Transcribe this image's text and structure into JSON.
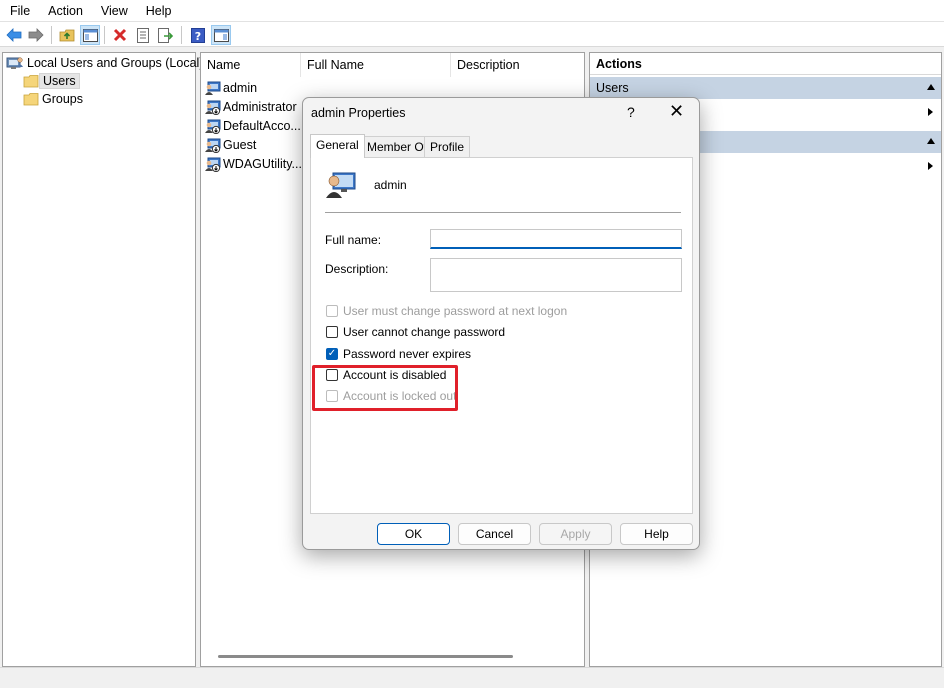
{
  "menu": [
    "File",
    "Action",
    "View",
    "Help"
  ],
  "toolbar": {
    "back": "back-arrow-icon",
    "forward": "forward-arrow-icon",
    "up": "up-folder-icon",
    "show_hide_tree": "console-tree-icon",
    "delete": "delete-icon",
    "properties": "properties-icon",
    "export": "export-icon",
    "help": "help-icon",
    "action_pane": "action-pane-icon"
  },
  "tree": {
    "root": "Local Users and Groups (Local)",
    "items": [
      "Users",
      "Groups"
    ],
    "selected": "Users"
  },
  "list": {
    "columns": [
      "Name",
      "Full Name",
      "Description"
    ],
    "rows": [
      "admin",
      "Administrator",
      "DefaultAcco...",
      "Guest",
      "WDAGUtility..."
    ]
  },
  "actions": {
    "title": "Actions",
    "sections": [
      {
        "label": "Users"
      },
      {
        "label": ""
      }
    ]
  },
  "dialog": {
    "title": "admin Properties",
    "help": "?",
    "close": "✕",
    "tabs": [
      "General",
      "Member Of",
      "Profile"
    ],
    "active_tab": "General",
    "user_name": "admin",
    "full_name_label": "Full name:",
    "full_name_value": "",
    "description_label": "Description:",
    "description_value": "",
    "checkboxes": [
      {
        "label": "User must change password at next logon",
        "checked": false,
        "disabled": true
      },
      {
        "label": "User cannot change password",
        "checked": false,
        "disabled": false
      },
      {
        "label": "Password never expires",
        "checked": true,
        "disabled": false
      },
      {
        "label": "Account is disabled",
        "checked": false,
        "disabled": false
      },
      {
        "label": "Account is locked out",
        "checked": false,
        "disabled": true
      }
    ],
    "buttons": {
      "ok": "OK",
      "cancel": "Cancel",
      "apply": "Apply",
      "help": "Help"
    },
    "highlight_color": "#e0202a",
    "accent_color": "#005fb8"
  }
}
